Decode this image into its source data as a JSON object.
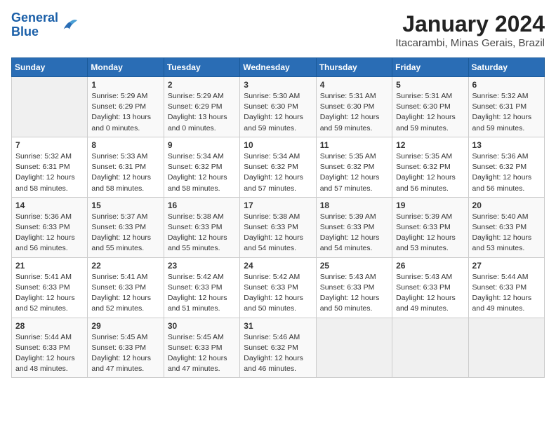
{
  "logo": {
    "line1": "General",
    "line2": "Blue"
  },
  "title": "January 2024",
  "subtitle": "Itacarambi, Minas Gerais, Brazil",
  "weekdays": [
    "Sunday",
    "Monday",
    "Tuesday",
    "Wednesday",
    "Thursday",
    "Friday",
    "Saturday"
  ],
  "weeks": [
    [
      {
        "day": "",
        "info": ""
      },
      {
        "day": "1",
        "info": "Sunrise: 5:29 AM\nSunset: 6:29 PM\nDaylight: 13 hours\nand 0 minutes."
      },
      {
        "day": "2",
        "info": "Sunrise: 5:29 AM\nSunset: 6:29 PM\nDaylight: 13 hours\nand 0 minutes."
      },
      {
        "day": "3",
        "info": "Sunrise: 5:30 AM\nSunset: 6:30 PM\nDaylight: 12 hours\nand 59 minutes."
      },
      {
        "day": "4",
        "info": "Sunrise: 5:31 AM\nSunset: 6:30 PM\nDaylight: 12 hours\nand 59 minutes."
      },
      {
        "day": "5",
        "info": "Sunrise: 5:31 AM\nSunset: 6:30 PM\nDaylight: 12 hours\nand 59 minutes."
      },
      {
        "day": "6",
        "info": "Sunrise: 5:32 AM\nSunset: 6:31 PM\nDaylight: 12 hours\nand 59 minutes."
      }
    ],
    [
      {
        "day": "7",
        "info": "Sunrise: 5:32 AM\nSunset: 6:31 PM\nDaylight: 12 hours\nand 58 minutes."
      },
      {
        "day": "8",
        "info": "Sunrise: 5:33 AM\nSunset: 6:31 PM\nDaylight: 12 hours\nand 58 minutes."
      },
      {
        "day": "9",
        "info": "Sunrise: 5:34 AM\nSunset: 6:32 PM\nDaylight: 12 hours\nand 58 minutes."
      },
      {
        "day": "10",
        "info": "Sunrise: 5:34 AM\nSunset: 6:32 PM\nDaylight: 12 hours\nand 57 minutes."
      },
      {
        "day": "11",
        "info": "Sunrise: 5:35 AM\nSunset: 6:32 PM\nDaylight: 12 hours\nand 57 minutes."
      },
      {
        "day": "12",
        "info": "Sunrise: 5:35 AM\nSunset: 6:32 PM\nDaylight: 12 hours\nand 56 minutes."
      },
      {
        "day": "13",
        "info": "Sunrise: 5:36 AM\nSunset: 6:32 PM\nDaylight: 12 hours\nand 56 minutes."
      }
    ],
    [
      {
        "day": "14",
        "info": "Sunrise: 5:36 AM\nSunset: 6:33 PM\nDaylight: 12 hours\nand 56 minutes."
      },
      {
        "day": "15",
        "info": "Sunrise: 5:37 AM\nSunset: 6:33 PM\nDaylight: 12 hours\nand 55 minutes."
      },
      {
        "day": "16",
        "info": "Sunrise: 5:38 AM\nSunset: 6:33 PM\nDaylight: 12 hours\nand 55 minutes."
      },
      {
        "day": "17",
        "info": "Sunrise: 5:38 AM\nSunset: 6:33 PM\nDaylight: 12 hours\nand 54 minutes."
      },
      {
        "day": "18",
        "info": "Sunrise: 5:39 AM\nSunset: 6:33 PM\nDaylight: 12 hours\nand 54 minutes."
      },
      {
        "day": "19",
        "info": "Sunrise: 5:39 AM\nSunset: 6:33 PM\nDaylight: 12 hours\nand 53 minutes."
      },
      {
        "day": "20",
        "info": "Sunrise: 5:40 AM\nSunset: 6:33 PM\nDaylight: 12 hours\nand 53 minutes."
      }
    ],
    [
      {
        "day": "21",
        "info": "Sunrise: 5:41 AM\nSunset: 6:33 PM\nDaylight: 12 hours\nand 52 minutes."
      },
      {
        "day": "22",
        "info": "Sunrise: 5:41 AM\nSunset: 6:33 PM\nDaylight: 12 hours\nand 52 minutes."
      },
      {
        "day": "23",
        "info": "Sunrise: 5:42 AM\nSunset: 6:33 PM\nDaylight: 12 hours\nand 51 minutes."
      },
      {
        "day": "24",
        "info": "Sunrise: 5:42 AM\nSunset: 6:33 PM\nDaylight: 12 hours\nand 50 minutes."
      },
      {
        "day": "25",
        "info": "Sunrise: 5:43 AM\nSunset: 6:33 PM\nDaylight: 12 hours\nand 50 minutes."
      },
      {
        "day": "26",
        "info": "Sunrise: 5:43 AM\nSunset: 6:33 PM\nDaylight: 12 hours\nand 49 minutes."
      },
      {
        "day": "27",
        "info": "Sunrise: 5:44 AM\nSunset: 6:33 PM\nDaylight: 12 hours\nand 49 minutes."
      }
    ],
    [
      {
        "day": "28",
        "info": "Sunrise: 5:44 AM\nSunset: 6:33 PM\nDaylight: 12 hours\nand 48 minutes."
      },
      {
        "day": "29",
        "info": "Sunrise: 5:45 AM\nSunset: 6:33 PM\nDaylight: 12 hours\nand 47 minutes."
      },
      {
        "day": "30",
        "info": "Sunrise: 5:45 AM\nSunset: 6:33 PM\nDaylight: 12 hours\nand 47 minutes."
      },
      {
        "day": "31",
        "info": "Sunrise: 5:46 AM\nSunset: 6:32 PM\nDaylight: 12 hours\nand 46 minutes."
      },
      {
        "day": "",
        "info": ""
      },
      {
        "day": "",
        "info": ""
      },
      {
        "day": "",
        "info": ""
      }
    ]
  ]
}
